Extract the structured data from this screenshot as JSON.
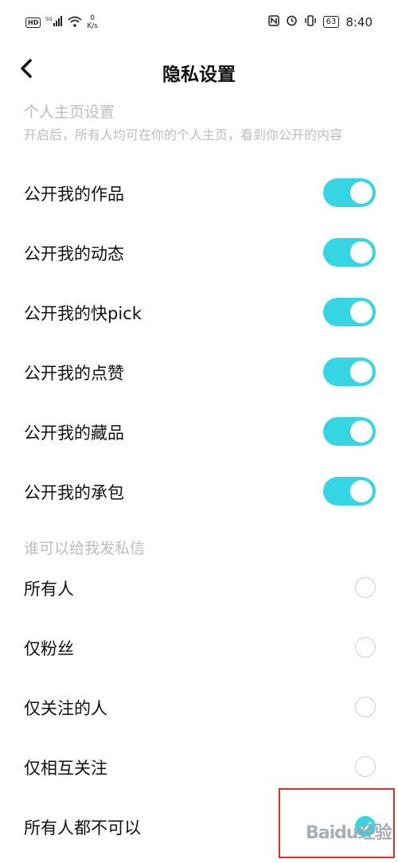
{
  "status_bar": {
    "hd": "HD",
    "net": "5G",
    "speed_value": "0",
    "speed_unit": "K/s",
    "battery": "63",
    "time": "8:40"
  },
  "header": {
    "title": "隐私设置"
  },
  "profile_section": {
    "title": "个人主页设置",
    "description": "开启后，所有人均可在你的个人主页，看到你公开的内容",
    "items": [
      {
        "label": "公开我的作品",
        "enabled": true
      },
      {
        "label": "公开我的动态",
        "enabled": true
      },
      {
        "label": "公开我的快pick",
        "enabled": true
      },
      {
        "label": "公开我的点赞",
        "enabled": true
      },
      {
        "label": "公开我的藏品",
        "enabled": true
      },
      {
        "label": "公开我的承包",
        "enabled": true
      }
    ]
  },
  "message_section": {
    "title": "谁可以给我发私信",
    "options": [
      {
        "label": "所有人",
        "selected": false
      },
      {
        "label": "仅粉丝",
        "selected": false
      },
      {
        "label": "仅关注的人",
        "selected": false
      },
      {
        "label": "仅相互关注",
        "selected": false
      },
      {
        "label": "所有人都不可以",
        "selected": true
      }
    ]
  },
  "colors": {
    "accent": "#35d5e4",
    "highlight": "#d9302c"
  },
  "watermark": "Baidu经验"
}
